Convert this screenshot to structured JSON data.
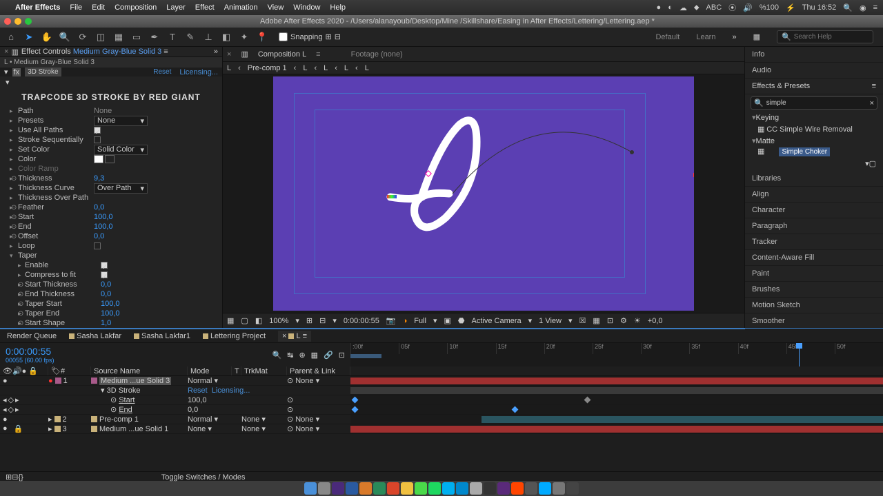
{
  "menubar": {
    "app": "After Effects",
    "items": [
      "File",
      "Edit",
      "Composition",
      "Layer",
      "Effect",
      "Animation",
      "View",
      "Window",
      "Help"
    ],
    "battery": "%100",
    "clock": "Thu 16:52",
    "input": "ABC"
  },
  "titlebar": "Adobe After Effects 2020 - /Users/alanayoub/Desktop/Mine /Skillshare/Easing in After Effects/Lettering/Lettering.aep *",
  "toolbar": {
    "snapping": "Snapping",
    "workspaces": [
      "Default",
      "Learn"
    ],
    "search_ph": "Search Help"
  },
  "effect_controls": {
    "tab_prefix": "Effect Controls ",
    "tab_layer": "Medium Gray-Blue Solid 3",
    "layer_path": "L • Medium Gray-Blue Solid 3",
    "fx_name": "3D Stroke",
    "reset": "Reset",
    "licensing": "Licensing...",
    "brand": "TRAPCODE 3D STROKE BY RED GIANT",
    "props": [
      {
        "n": "Path",
        "v": "None",
        "type": "label"
      },
      {
        "n": "Presets",
        "v": "None",
        "type": "select"
      },
      {
        "n": "Use All Paths",
        "type": "check",
        "on": true
      },
      {
        "n": "Stroke Sequentially",
        "type": "check",
        "on": false
      },
      {
        "n": "Set Color",
        "v": "Solid Color",
        "type": "select"
      },
      {
        "n": "Color",
        "type": "color"
      },
      {
        "n": "Color Ramp",
        "type": "group",
        "dim": true
      },
      {
        "n": "Thickness",
        "v": "9,3",
        "type": "val",
        "sw": true
      },
      {
        "n": "Thickness Curve",
        "v": "Over Path",
        "type": "select"
      },
      {
        "n": "Thickness Over Path",
        "type": "group"
      },
      {
        "n": "Feather",
        "v": "0,0",
        "type": "val",
        "sw": true
      },
      {
        "n": "Start",
        "v": "100,0",
        "type": "val",
        "sw": true
      },
      {
        "n": "End",
        "v": "100,0",
        "type": "val",
        "sw": true
      },
      {
        "n": "Offset",
        "v": "0,0",
        "type": "val",
        "sw": true
      },
      {
        "n": "Loop",
        "type": "check",
        "on": false
      },
      {
        "n": "Taper",
        "type": "group",
        "open": true
      },
      {
        "n": "Enable",
        "type": "check",
        "on": true,
        "indent": 1
      },
      {
        "n": "Compress to fit",
        "type": "check",
        "on": true,
        "indent": 1
      },
      {
        "n": "Start Thickness",
        "v": "0,0",
        "type": "val",
        "sw": true,
        "indent": 1
      },
      {
        "n": "End Thickness",
        "v": "0,0",
        "type": "val",
        "sw": true,
        "indent": 1
      },
      {
        "n": "Taper Start",
        "v": "100,0",
        "type": "val",
        "sw": true,
        "indent": 1
      },
      {
        "n": "Taper End",
        "v": "100,0",
        "type": "val",
        "sw": true,
        "indent": 1
      },
      {
        "n": "Start Shape",
        "v": "1,0",
        "type": "val",
        "sw": true,
        "indent": 1
      }
    ]
  },
  "composition": {
    "tab": "Composition L",
    "footage": "Footage (none)",
    "breadcrumb": [
      "L",
      "Pre-comp 1",
      "L",
      "L",
      "L",
      "L"
    ],
    "viewbar": {
      "zoom": "100%",
      "time": "0:00:00:55",
      "res": "Full",
      "camera": "Active Camera",
      "views": "1 View",
      "exp": "+0,0"
    }
  },
  "right": {
    "panels": [
      "Info",
      "Audio",
      "Effects & Presets"
    ],
    "search": "simple",
    "tree": [
      {
        "cat": "Keying",
        "items": [
          "CC Simple Wire Removal"
        ]
      },
      {
        "cat": "Matte",
        "items": [
          "Simple Choker"
        ],
        "sel": 0
      }
    ],
    "panels2": [
      "Libraries",
      "Align",
      "Character",
      "Paragraph",
      "Tracker",
      "Content-Aware Fill",
      "Paint",
      "Brushes",
      "Motion Sketch",
      "Smoother"
    ]
  },
  "timeline": {
    "tabs": [
      "Render Queue",
      "Sasha Lakfar",
      "Sasha Lakfar1",
      "Lettering Project",
      "L"
    ],
    "active_tab": 4,
    "timecode": "0:00:00:55",
    "fps": "00055 (60.00 fps)",
    "ruler": [
      ":00f",
      "05f",
      "10f",
      "15f",
      "20f",
      "25f",
      "30f",
      "35f",
      "40f",
      "45f",
      "50f"
    ],
    "cols": [
      "#",
      "Source Name",
      "Mode",
      "T",
      "TrkMat",
      "Parent & Link"
    ],
    "rows": [
      {
        "num": "1",
        "name": "Medium ...ue Solid 3",
        "mode": "Normal",
        "trk": "",
        "parent": "None",
        "color": "#a85a8a",
        "sel": true
      },
      {
        "fx": "3D Stroke",
        "reset": "Reset",
        "licensing": "Licensing..."
      },
      {
        "prop": "Start",
        "v": "100,0"
      },
      {
        "prop": "End",
        "v": "0,0"
      },
      {
        "num": "2",
        "name": "Pre-comp 1",
        "mode": "Normal",
        "trk": "None",
        "parent": "None",
        "color": "#c9b27a"
      },
      {
        "num": "3",
        "name": "Medium ...ue Solid 1",
        "mode": "None",
        "trk": "None",
        "parent": "None",
        "color": "#c9b27a",
        "lock": true
      }
    ],
    "footer": "Toggle Switches / Modes"
  }
}
